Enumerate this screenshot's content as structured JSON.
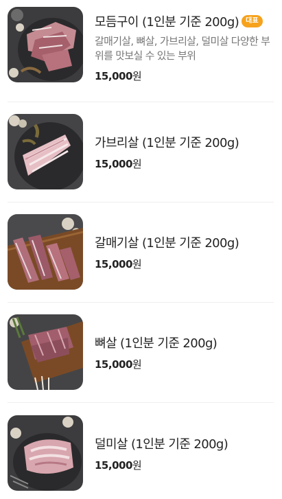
{
  "menu": {
    "items": [
      {
        "name": "모듬구이 (1인분 기준 200g)",
        "badge": "대표",
        "description": "갈매기살, 뼈살, 가브리살, 덜미살 다양한 부위를 맛보실 수 있는 부위",
        "price_amount": "15,000",
        "price_unit": "원",
        "image_icon": "assorted-pork-photo"
      },
      {
        "name": "가브리살 (1인분 기준 200g)",
        "price_amount": "15,000",
        "price_unit": "원",
        "image_icon": "gabrisal-pork-photo"
      },
      {
        "name": "갈매기살 (1인분 기준 200g)",
        "price_amount": "15,000",
        "price_unit": "원",
        "image_icon": "galmaegisal-pork-photo"
      },
      {
        "name": "뼈살 (1인분 기준 200g)",
        "price_amount": "15,000",
        "price_unit": "원",
        "image_icon": "bbyeosal-pork-photo"
      },
      {
        "name": "덜미살 (1인분 기준 200g)",
        "price_amount": "15,000",
        "price_unit": "원",
        "image_icon": "deolmisal-pork-photo"
      }
    ]
  },
  "colors": {
    "badge": "#f6a21c",
    "text": "#222222",
    "description": "#777777",
    "divider": "#eeeeee"
  }
}
